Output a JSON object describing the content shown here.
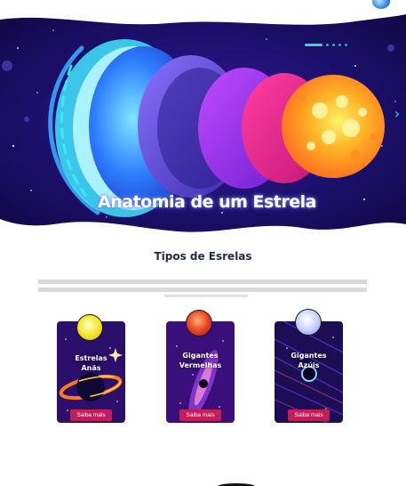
{
  "hero": {
    "title": "Anatomia de um Estrela",
    "next_icon": "›"
  },
  "section": {
    "title": "Tipos de Esrelas"
  },
  "cards": [
    {
      "title_line1": "Estrelas",
      "title_line2": "Anãs",
      "button_label": "Saiba mais",
      "star_color": "#f5e93a"
    },
    {
      "title_line1": "Gigantes",
      "title_line2": "Vermelhas",
      "button_label": "Saiba mais",
      "star_color": "#e8432a"
    },
    {
      "title_line1": "Gigantes",
      "title_line2": "Azúis",
      "button_label": "Saiba mais",
      "star_color": "#c9d4ff"
    }
  ],
  "colors": {
    "accent": "#3fd0d6",
    "button": "#c41e5a",
    "title_text": "#1f2b47"
  }
}
